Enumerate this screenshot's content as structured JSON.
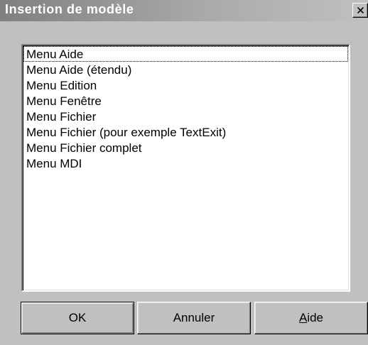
{
  "window": {
    "title": "Insertion de modèle",
    "close_icon": "close-x-icon"
  },
  "list": {
    "items": [
      "Menu Aide",
      "Menu Aide (étendu)",
      "Menu Edition",
      "Menu Fenêtre",
      "Menu Fichier",
      "Menu Fichier (pour exemple TextExit)",
      "Menu Fichier complet",
      "Menu MDI"
    ],
    "focused_index": 0
  },
  "buttons": {
    "ok_label": "OK",
    "cancel_label": "Annuler",
    "help_label_accel": "A",
    "help_label_rest": "ide"
  }
}
